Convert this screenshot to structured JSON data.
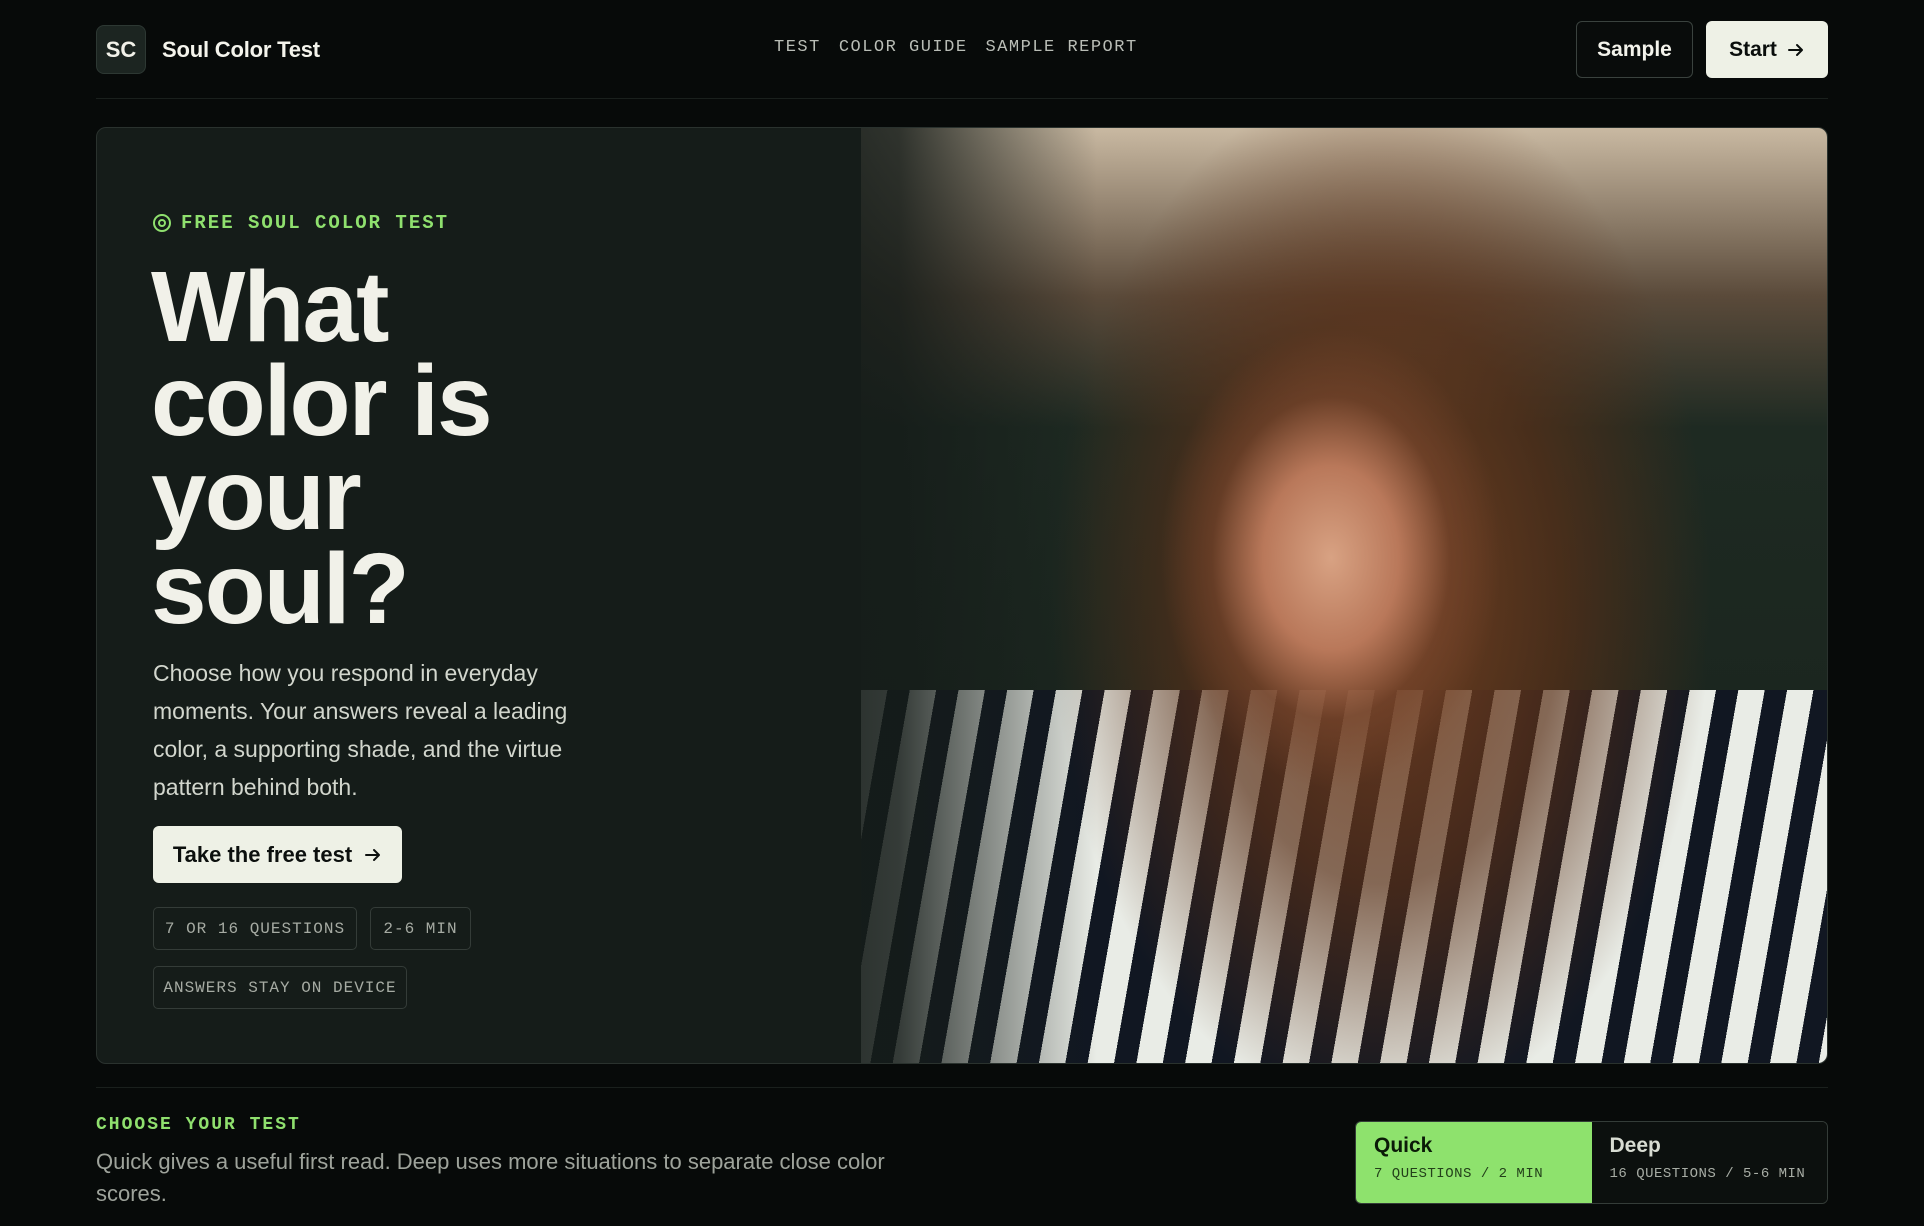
{
  "header": {
    "logo_initials": "SC",
    "app_name": "Soul Color Test",
    "nav": [
      "TEST",
      "COLOR GUIDE",
      "SAMPLE REPORT"
    ],
    "sample_label": "Sample",
    "start_label": "Start",
    "start_icon": "arrow-right-icon"
  },
  "hero": {
    "eyebrow": "FREE SOUL COLOR TEST",
    "eyebrow_icon": "target-icon",
    "headline": "What color is your soul?",
    "lead": "Choose how you respond in everyday moments. Your answers reveal a leading color, a supporting shade, and the virtue pattern behind both.",
    "cta_label": "Take the free test",
    "chips": [
      "7 OR 16 QUESTIONS",
      "2-6 MIN",
      "ANSWERS STAY ON DEVICE"
    ]
  },
  "choose": {
    "title": "CHOOSE YOUR TEST",
    "description": "Quick gives a useful first read. Deep uses more situations to separate close color scores.",
    "options": [
      {
        "title": "Quick",
        "subtitle": "7 QUESTIONS / 2 MIN",
        "selected": true
      },
      {
        "title": "Deep",
        "subtitle": "16 QUESTIONS / 5-6 MIN",
        "selected": false
      }
    ]
  },
  "colors": {
    "accent_green": "#8ee26d",
    "background": "#070a09",
    "button_light": "#eef1e6"
  }
}
